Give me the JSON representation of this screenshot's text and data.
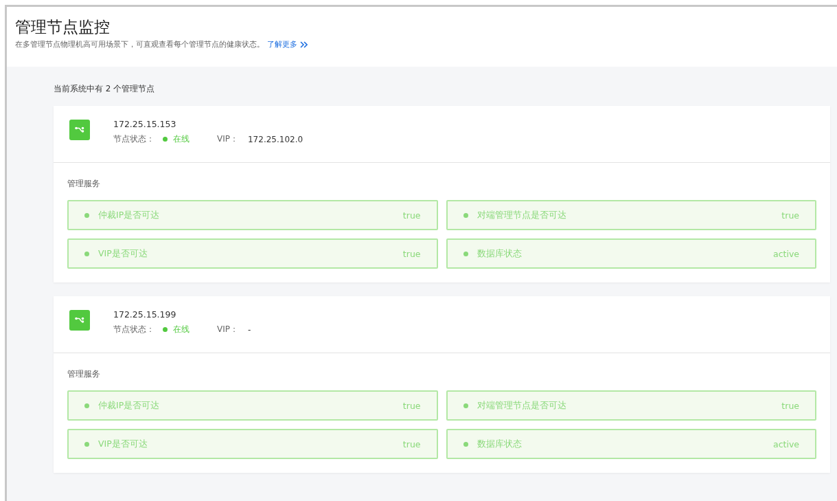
{
  "header": {
    "title": "管理节点监控",
    "description": "在多管理节点物理机高可用场景下，可直观查看每个管理节点的健康状态。",
    "link": "了解更多"
  },
  "summary": "当前系统中有 2 个管理节点",
  "nodes": [
    {
      "ip": "172.25.15.153",
      "status_label": "节点状态：",
      "status": "在线",
      "online": true,
      "vip_label": "VIP：",
      "vip": "172.25.102.0",
      "services_title": "管理服务",
      "services": [
        {
          "name": "仲裁IP是否可达",
          "value": "true",
          "healthy": true
        },
        {
          "name": "对端管理节点是否可达",
          "value": "true",
          "healthy": true
        },
        {
          "name": "VIP是否可达",
          "value": "true",
          "healthy": true
        },
        {
          "name": "数据库状态",
          "value": "active",
          "healthy": true
        }
      ]
    },
    {
      "ip": "172.25.15.199",
      "status_label": "节点状态：",
      "status": "在线",
      "online": true,
      "vip_label": "VIP：",
      "vip": "-",
      "services_title": "管理服务",
      "services": [
        {
          "name": "仲裁IP是否可达",
          "value": "true",
          "healthy": true
        },
        {
          "name": "对端管理节点是否可达",
          "value": "true",
          "healthy": true
        },
        {
          "name": "VIP是否可达",
          "value": "true",
          "healthy": true
        },
        {
          "name": "数据库状态",
          "value": "active",
          "healthy": true
        }
      ]
    }
  ]
}
